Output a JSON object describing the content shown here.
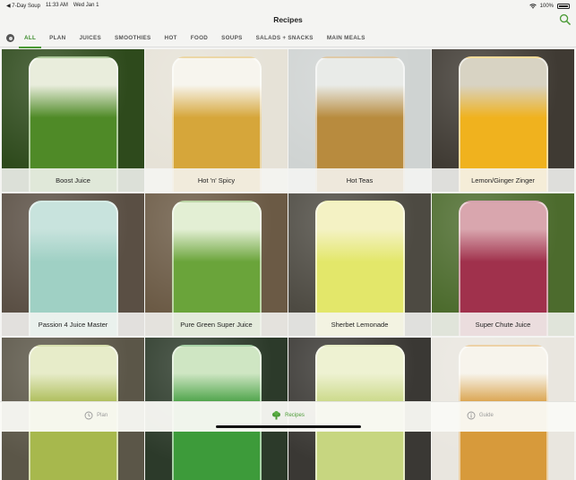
{
  "status_bar": {
    "back_app": "◀ 7-Day Soup",
    "time": "11:33 AM",
    "date": "Wed Jan 1",
    "battery": "100%"
  },
  "header": {
    "title": "Recipes"
  },
  "tabs": [
    {
      "label": "ALL",
      "active": true
    },
    {
      "label": "PLAN"
    },
    {
      "label": "JUICES"
    },
    {
      "label": "SMOOTHIES"
    },
    {
      "label": "HOT"
    },
    {
      "label": "FOOD"
    },
    {
      "label": "SOUPS"
    },
    {
      "label": "SALADS + SNACKS"
    },
    {
      "label": "MAIN MEALS"
    }
  ],
  "recipes": [
    {
      "label": "Boost Juice",
      "colors": [
        "#2e4a1c",
        "#4f8a27",
        "#e9eddc"
      ]
    },
    {
      "label": "Hot 'n' Spicy",
      "colors": [
        "#e6e2d7",
        "#d6a63a",
        "#f7f5ee"
      ]
    },
    {
      "label": "Hot Teas",
      "colors": [
        "#cfd3d2",
        "#b88b3e",
        "#e9ebe8"
      ]
    },
    {
      "label": "Lemon/Ginger Zinger",
      "colors": [
        "#3f3a33",
        "#f0b21e",
        "#d8d3c3"
      ]
    },
    {
      "label": "Passion 4 Juice Master",
      "colors": [
        "#5a4f44",
        "#9fd0c4",
        "#c8e3dd"
      ]
    },
    {
      "label": "Pure Green Super Juice",
      "colors": [
        "#6b5a45",
        "#6aa43a",
        "#e3efd4"
      ]
    },
    {
      "label": "Sherbet Lemonade",
      "colors": [
        "#4d4a42",
        "#e3e76a",
        "#f4f2c4"
      ]
    },
    {
      "label": "Super Chute Juice",
      "colors": [
        "#4c6b2d",
        "#a0314c",
        "#d9a6ae"
      ]
    },
    {
      "label": "",
      "colors": [
        "#5b5648",
        "#a7b84d",
        "#e7ecc9"
      ]
    },
    {
      "label": "",
      "colors": [
        "#2c3a2a",
        "#3d9b3a",
        "#cfe6c3"
      ]
    },
    {
      "label": "",
      "colors": [
        "#3a3834",
        "#c7d680",
        "#eef2d2"
      ]
    },
    {
      "label": "",
      "colors": [
        "#e9e6df",
        "#d79a3b",
        "#f7f4ec"
      ]
    }
  ],
  "tab_bar": {
    "items": [
      {
        "label": "Plan",
        "icon": "clock-icon"
      },
      {
        "label": "Recipes",
        "icon": "broccoli-icon",
        "active": true
      },
      {
        "label": "Guide",
        "icon": "info-icon"
      }
    ]
  },
  "accent_color": "#4b9b36"
}
